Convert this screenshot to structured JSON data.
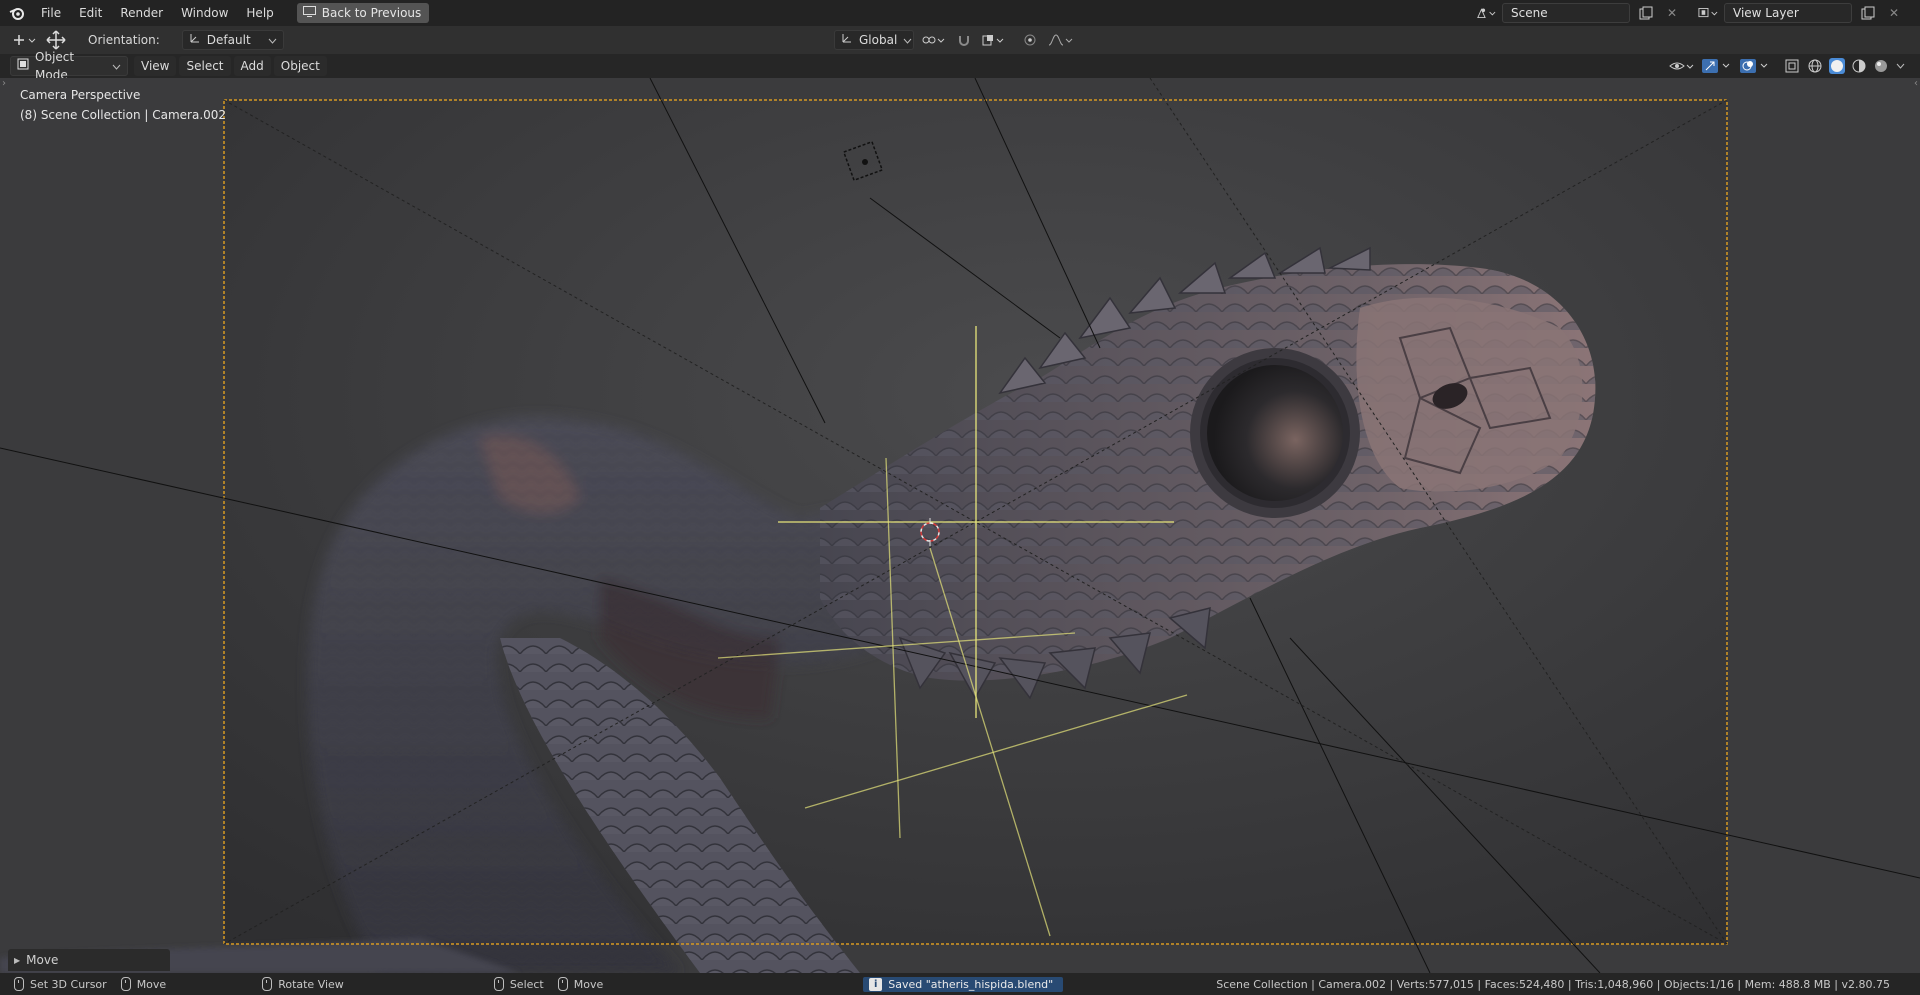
{
  "menu": {
    "items": [
      "File",
      "Edit",
      "Render",
      "Window",
      "Help"
    ],
    "back_button": "Back to Previous"
  },
  "scene": {
    "label": "Scene"
  },
  "view_layer": {
    "label": "View Layer"
  },
  "toolbar": {
    "orientation_label": "Orientation:",
    "orientation_value": "Default",
    "transform_space": "Global"
  },
  "header": {
    "mode": "Object Mode",
    "menus": [
      "View",
      "Select",
      "Add",
      "Object"
    ]
  },
  "viewport": {
    "perspective": "Camera Perspective",
    "collection": "(8) Scene Collection | Camera.002"
  },
  "operator_panel": {
    "label": "Move"
  },
  "status": {
    "set_cursor": "Set 3D Cursor",
    "move": "Move",
    "rotate": "Rotate View",
    "select": "Select",
    "move2": "Move",
    "saved": "Saved \"atheris_hispida.blend\"",
    "stats": "Scene Collection | Camera.002 | Verts:577,015 | Faces:524,480 | Tris:1,048,960 | Objects:1/16 | Mem: 488.8 MB | v2.80.75"
  },
  "colors": {
    "camera_frame": "#d79a22",
    "accent": "#4a8bd6",
    "selection_yellow": "#e6e47a"
  }
}
